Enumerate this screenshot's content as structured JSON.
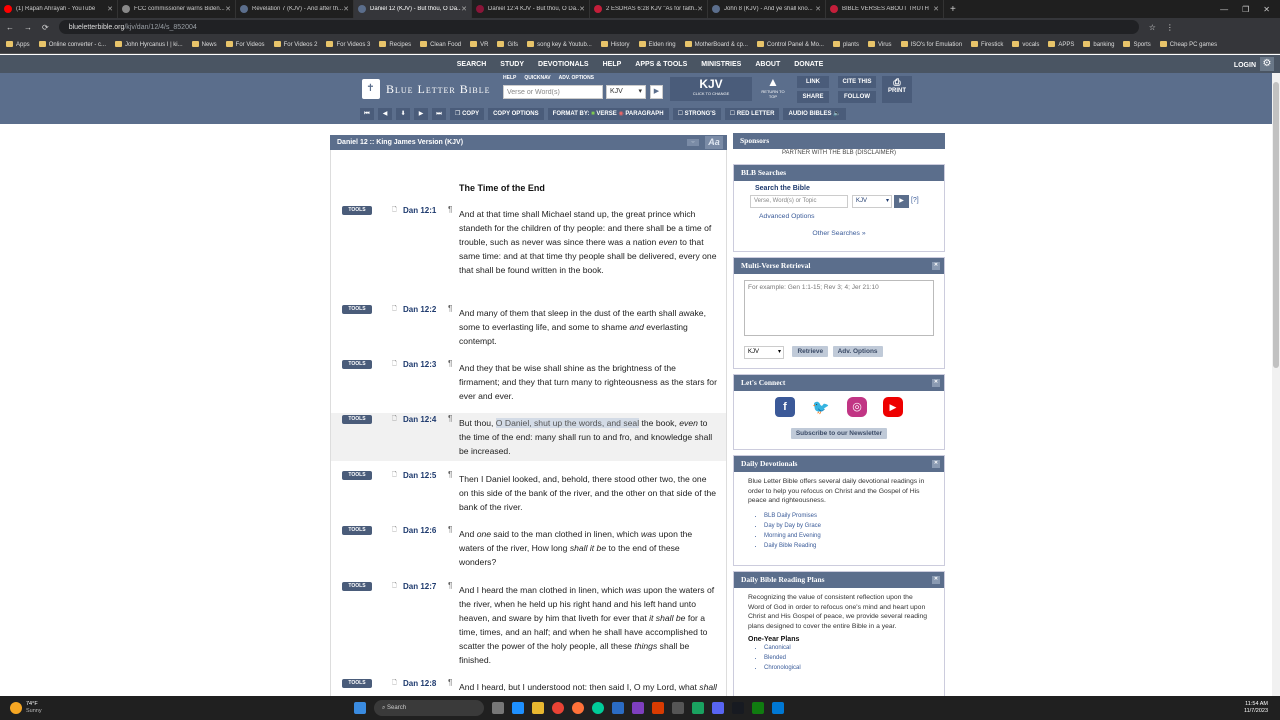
{
  "browser": {
    "tabs": [
      {
        "label": "(1) Rapah Ahrayah - YouTube",
        "color": "#ff0000"
      },
      {
        "label": "FCC commissioner warns Biden...",
        "color": "#888888"
      },
      {
        "label": "Revelation 7 (KJV) - And after th...",
        "color": "#5b6e8c"
      },
      {
        "label": "Daniel 12 (KJV) - But thou, O Da...",
        "color": "#5b6e8c"
      },
      {
        "label": "Daniel 12:4 KJV - But thou, O Da...",
        "color": "#8a1538"
      },
      {
        "label": "2 ESDRAS 6:28 KJV \"As for faith...",
        "color": "#c41e3a"
      },
      {
        "label": "John 8 (KJV) - And ye shall kno...",
        "color": "#5b6e8c"
      },
      {
        "label": "BIBLE VERSES ABOUT TRUTH",
        "color": "#c41e3a"
      }
    ],
    "url_domain": "blueletterbible.org",
    "url_path": "/kjv/dan/12/4/s_852004",
    "bookmarks": [
      "Apps",
      "Online converter - c...",
      "John Hyrcanus I | ki...",
      "News",
      "For Videos",
      "For Videos 2",
      "For Videos 3",
      "Recipes",
      "Clean Food",
      "VR",
      "Gifs",
      "song key & Youtub...",
      "History",
      "Elden ring",
      "MotherBoard & cp...",
      "Control Panel & Mo...",
      "plants",
      "Virus",
      "ISO's for Emulation",
      "Firestick",
      "vocals",
      "APPS",
      "banking",
      "Sports",
      "Cheap PC games"
    ]
  },
  "topnav": {
    "items": [
      "SEARCH",
      "STUDY",
      "DEVOTIONALS",
      "HELP",
      "APPS & TOOLS",
      "MINISTRIES",
      "ABOUT",
      "DONATE"
    ],
    "login": "LOGIN"
  },
  "header": {
    "logo": "Blue Letter Bible",
    "links": [
      "HELP",
      "QUICKNAV",
      "ADV. OPTIONS"
    ],
    "search_placeholder": "Verse or Word(s)",
    "version": "KJV",
    "kjv_big": "KJV",
    "kjv_sub": "CLICK TO CHANGE",
    "return_top": "RETURN TO TOP",
    "buttons": {
      "link": "LINK",
      "share": "SHARE",
      "cite": "CITE THIS",
      "follow": "FOLLOW",
      "print": "PRINT"
    },
    "toolrow": {
      "copy": "COPY",
      "copy_options": "COPY OPTIONS",
      "format_by": "FORMAT BY:",
      "verse": "VERSE",
      "paragraph": "PARAGRAPH",
      "strongs": "STRONG'S",
      "red_letter": "RED LETTER",
      "audio": "AUDIO BIBLES"
    }
  },
  "chapter": {
    "heading": "Daniel 12 :: King James Version (KJV)",
    "aa": "Aa",
    "section_title": "The Time of the End",
    "tools_label": "TOOLS",
    "verses": [
      {
        "ref": "Dan 12:1",
        "text": "And at that time shall Michael stand up, the great prince which standeth for the children of thy people: and there shall be a time of trouble, such as never was since there was a nation <i>even</i> to that same time: and at that time thy people shall be delivered, every one that shall be found written in the book."
      },
      {
        "ref": "Dan 12:2",
        "text": "And many of them that sleep in the dust of the earth shall awake, some to everlasting life, and some to shame <i>and</i> everlasting contempt."
      },
      {
        "ref": "Dan 12:3",
        "text": "And they that be wise shall shine as the brightness of the firmament; and they that turn many to righteousness as the stars for ever and ever."
      },
      {
        "ref": "Dan 12:4",
        "text": "But thou, <span class=\"hlspan\">O Daniel, shut up the words, and seal</span> the book, <i>even</i> to the time of the end: many shall run to and fro, and knowledge shall be increased."
      },
      {
        "ref": "Dan 12:5",
        "text": "Then I Daniel looked, and, behold, there stood other two, the one on this side of the bank of the river, and the other on that side of the bank of the river."
      },
      {
        "ref": "Dan 12:6",
        "text": "And <i>one</i> said to the man clothed in linen, which <i>was</i> upon the waters of the river, How long <i>shall it be</i> to the end of these wonders?"
      },
      {
        "ref": "Dan 12:7",
        "text": "And I heard the man clothed in linen, which <i>was</i> upon the waters of the river, when he held up his right hand and his left hand unto heaven, and sware by him that liveth for ever that <i>it shall be</i> for a time, times, and an half; and when he shall have accomplished to scatter the power of the holy people, all these <i>things</i> shall be finished."
      },
      {
        "ref": "Dan 12:8",
        "text": "And I heard, but I understood not: then said I, O my Lord, what <i>shall be</i> the end of these <i>things</i>?"
      }
    ]
  },
  "sidebar": {
    "sponsors": "Sponsors",
    "partner": "PARTNER WITH THE BLB",
    "disclaimer": "(DISCLAIMER)",
    "searches_title": "BLB Searches",
    "search_label": "Search the Bible",
    "search_placeholder": "Verse, Word(s) or Topic",
    "search_version": "KJV",
    "help_q": "[?]",
    "advanced": "Advanced Options",
    "other": "Other Searches",
    "mvr_title": "Multi-Verse Retrieval",
    "mvr_placeholder": "For example: Gen 1:1-15; Rev 3; 4; Jer 21:10",
    "mvr_version": "KJV",
    "retrieve": "Retrieve",
    "adv_options": "Adv. Options",
    "connect_title": "Let's Connect",
    "newsletter": "Subscribe to our Newsletter",
    "dev_title": "Daily Devotionals",
    "dev_text": "Blue Letter Bible offers several daily devotional readings in order to help you refocus on Christ and the Gospel of His peace and righteousness.",
    "dev_items": [
      "BLB Daily Promises",
      "Day by Day by Grace",
      "Morning and Evening",
      "Daily Bible Reading"
    ],
    "plans_title": "Daily Bible Reading Plans",
    "plans_text": "Recognizing the value of consistent reflection upon the Word of God in order to refocus one's mind and heart upon Christ and His Gospel of peace, we provide several reading plans designed to cover the entire Bible in a year.",
    "one_year": "One-Year Plans",
    "plan_items": [
      "Canonical",
      "Blended",
      "Chronological"
    ]
  },
  "taskbar": {
    "weather_temp": "74°F",
    "weather_desc": "Sunny",
    "search": "Search",
    "time": "11:54 AM",
    "date": "11/7/2023"
  }
}
